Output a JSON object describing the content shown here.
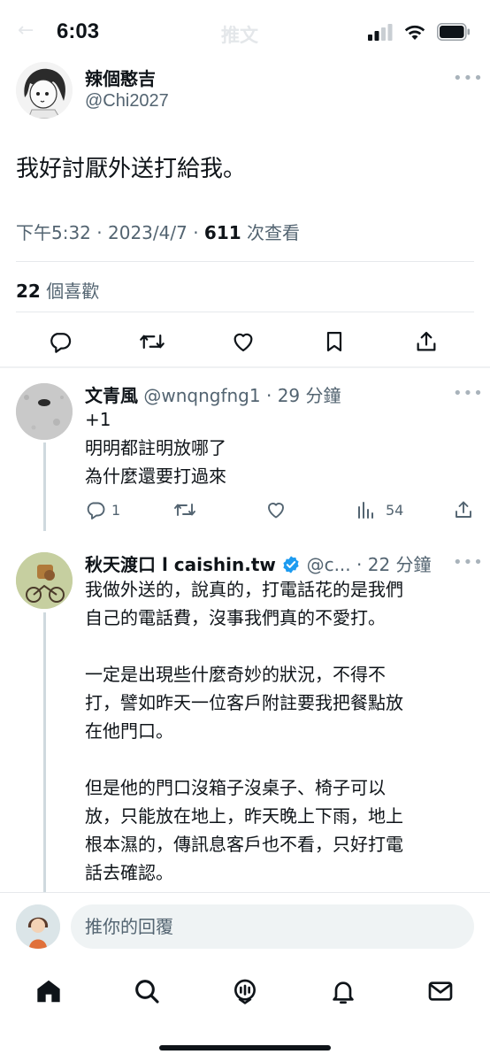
{
  "status_bar": {
    "time": "6:03"
  },
  "header": {
    "back_glyph": "←",
    "title": "推文"
  },
  "main_tweet": {
    "author_name": "辣個憨吉",
    "author_handle": "@Chi2027",
    "more_icon": "more-icon",
    "text": "我好討厭外送打給我。",
    "time": "下午5:32",
    "date": "2023/4/7",
    "views_count": "611",
    "views_label": "次查看",
    "likes_count": "22",
    "likes_label": "個喜歡"
  },
  "replies": [
    {
      "author_name": "文青風",
      "author_handle": "@wnqngfng1",
      "time_ago": "29 分鐘",
      "lines": [
        "+1",
        "明明都註明放哪了",
        "為什麼還要打過來"
      ],
      "reply_count": "1",
      "views_count": "54"
    },
    {
      "author_name": "秋天渡口 l caishin.tw",
      "verified": true,
      "author_handle": "@c...",
      "time_ago": "22 分鐘",
      "paragraphs": [
        [
          "我做外送的，說真的，打電話花的是我們",
          "自己的電話費，沒事我們真的不愛打。"
        ],
        [
          "一定是出現些什麼奇妙的狀況，不得不",
          "打，譬如昨天一位客戶附註要我把餐點放",
          "在他門口。"
        ],
        [
          "但是他的門口沒箱子沒桌子、椅子可以",
          "放，只能放在地上，昨天晚上下雨，地上",
          "根本濕的，傳訊息客戶也不看，只好打電",
          "話去確認。"
        ]
      ]
    }
  ],
  "compose": {
    "placeholder": "推你的回覆"
  },
  "tabbar": {
    "items": [
      "home-icon",
      "search-icon",
      "spaces-icon",
      "notifications-icon",
      "messages-icon"
    ]
  },
  "colors": {
    "accent": "#1d9bf0",
    "text": "#0f1419",
    "muted": "#536471"
  }
}
